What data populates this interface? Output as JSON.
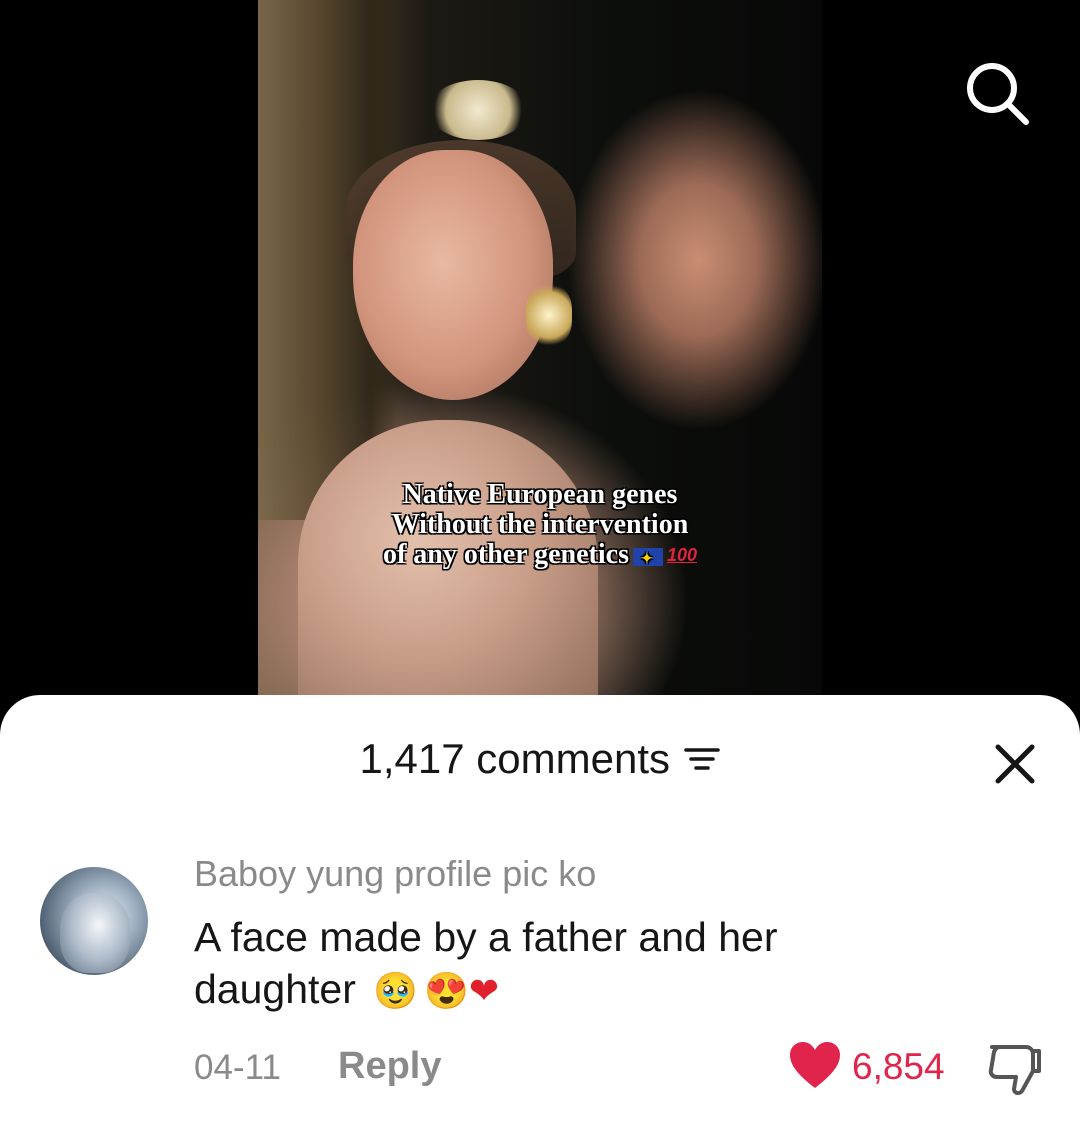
{
  "video": {
    "caption_lines": [
      "Native European genes",
      "Without the intervention",
      "of any other genetics"
    ],
    "caption_badge": "100"
  },
  "comments": {
    "count_label": "1,417 comments"
  },
  "comment": {
    "username": "Baboy yung profile pic ko",
    "text_line1": "A face made by a father and her",
    "text_line2": "daughter",
    "emoji_cry": "🥹",
    "emoji_hearteyes": "😍",
    "emoji_heart": "❤",
    "date": "04-11",
    "reply_label": "Reply",
    "like_count": "6,854"
  },
  "colors": {
    "like_accent": "#e0244b",
    "muted_text": "#8a8a8a"
  }
}
